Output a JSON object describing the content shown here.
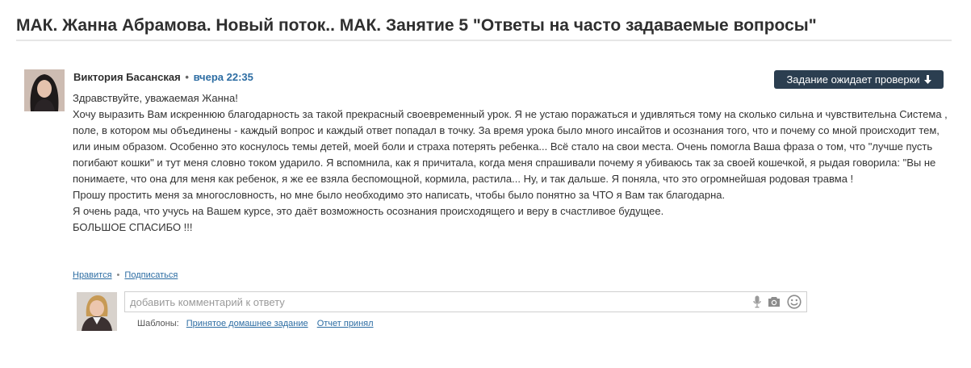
{
  "page": {
    "title": "МАК. Жанна Абрамова. Новый поток.. МАК. Занятие 5 \"Ответы на часто задаваемые вопросы\""
  },
  "comment": {
    "author": "Виктория Басанская",
    "separator": "•",
    "time": "вчера 22:35",
    "status_label": "Задание ожидает проверки",
    "status_icon": "arrow-down-icon",
    "paragraphs": [
      "Здравствуйте, уважаемая Жанна!",
      "Хочу выразить Вам искреннюю благодарность за такой прекрасный своевременный урок. Я не устаю поражаться и удивляться тому на сколько сильна и чувствительна Система , поле, в котором мы объединены - каждый вопрос и каждый ответ попадал в точку. За время урока было много инсайтов и осознания того, что и почему со мной происходит тем, или иным образом. Особенно это коснулось темы детей, моей боли и страха потерять ребенка... Всё стало на свои места. Очень помогла Ваша фраза о том, что \"лучше пусть погибают кошки\" и тут меня словно током ударило. Я вспомнила, как я причитала, когда меня спрашивали почему я убиваюсь так за своей кошечкой, я рыдая говорила: \"Вы не понимаете, что она для меня как ребенок, я же ее взяла беспомощной, кормила, растила... Ну, и так дальше. Я поняла, что это огромнейшая родовая травма !",
      "Прошу простить меня за многословность, но мне было необходимо это написать, чтобы было понятно за ЧТО я Вам так благодарна.",
      "Я очень рада, что учусь на Вашем курсе, это даёт возможность осознания происходящего и веру в счастливое будущее.",
      "БОЛЬШОЕ СПАСИБО !!!"
    ],
    "actions": {
      "like": "Нравится",
      "separator": "•",
      "subscribe": "Подписаться"
    }
  },
  "reply": {
    "placeholder": "добавить комментарий к ответу",
    "icons": [
      "microphone-icon",
      "camera-icon",
      "emoji-icon"
    ],
    "templates_label": "Шаблоны:",
    "templates": [
      "Принятое домашнее задание",
      "Отчет принял"
    ]
  },
  "colors": {
    "link": "#2d6da3",
    "badge_bg": "#2b3e50"
  }
}
